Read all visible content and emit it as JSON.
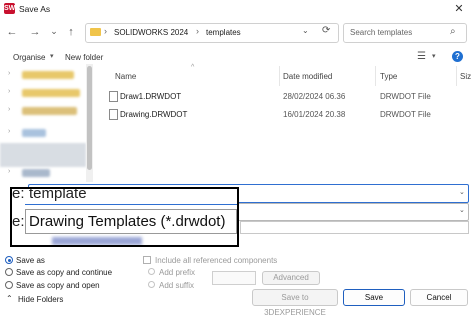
{
  "window": {
    "title": "Save As",
    "app_icon": "solidworks-logo-icon",
    "close_glyph": "✕"
  },
  "nav": {
    "back": "←",
    "forward": "→",
    "recent": "⌄",
    "up": "↑"
  },
  "address": {
    "crumbs": [
      "SOLIDWORKS 2024",
      "templates"
    ],
    "separator": "›",
    "dropdown": "⌄",
    "refresh": "⟳"
  },
  "search": {
    "placeholder": "Search templates",
    "icon": "⌕"
  },
  "toolbar": {
    "organise": "Organise",
    "new_folder": "New folder",
    "view_glyph": "☰",
    "caret": "▾",
    "help": "?"
  },
  "columns": {
    "name": "Name",
    "date": "Date modified",
    "type": "Type",
    "size": "Siz"
  },
  "files": [
    {
      "name": "Draw1.DRWDOT",
      "date": "28/02/2024 06.36",
      "type": "DRWDOT File"
    },
    {
      "name": "Drawing.DRWDOT",
      "date": "16/01/2024 20.38",
      "type": "DRWDOT File"
    }
  ],
  "form": {
    "filename": "template",
    "save_as_type": "Drawing Templates (*.drwdot)",
    "label_fragment": "e:"
  },
  "options": {
    "save_as": "Save as",
    "save_copy_continue": "Save as copy and continue",
    "save_copy_open": "Save as copy and open",
    "include_refs": "Include all referenced components",
    "add_prefix": "Add prefix",
    "add_suffix": "Add suffix",
    "advanced": "Advanced"
  },
  "buttons": {
    "threedx": "Save to 3DEXPERIENCE",
    "save": "Save",
    "cancel": "Cancel",
    "hide_folders": "Hide Folders",
    "hide_glyph": "⌃"
  }
}
